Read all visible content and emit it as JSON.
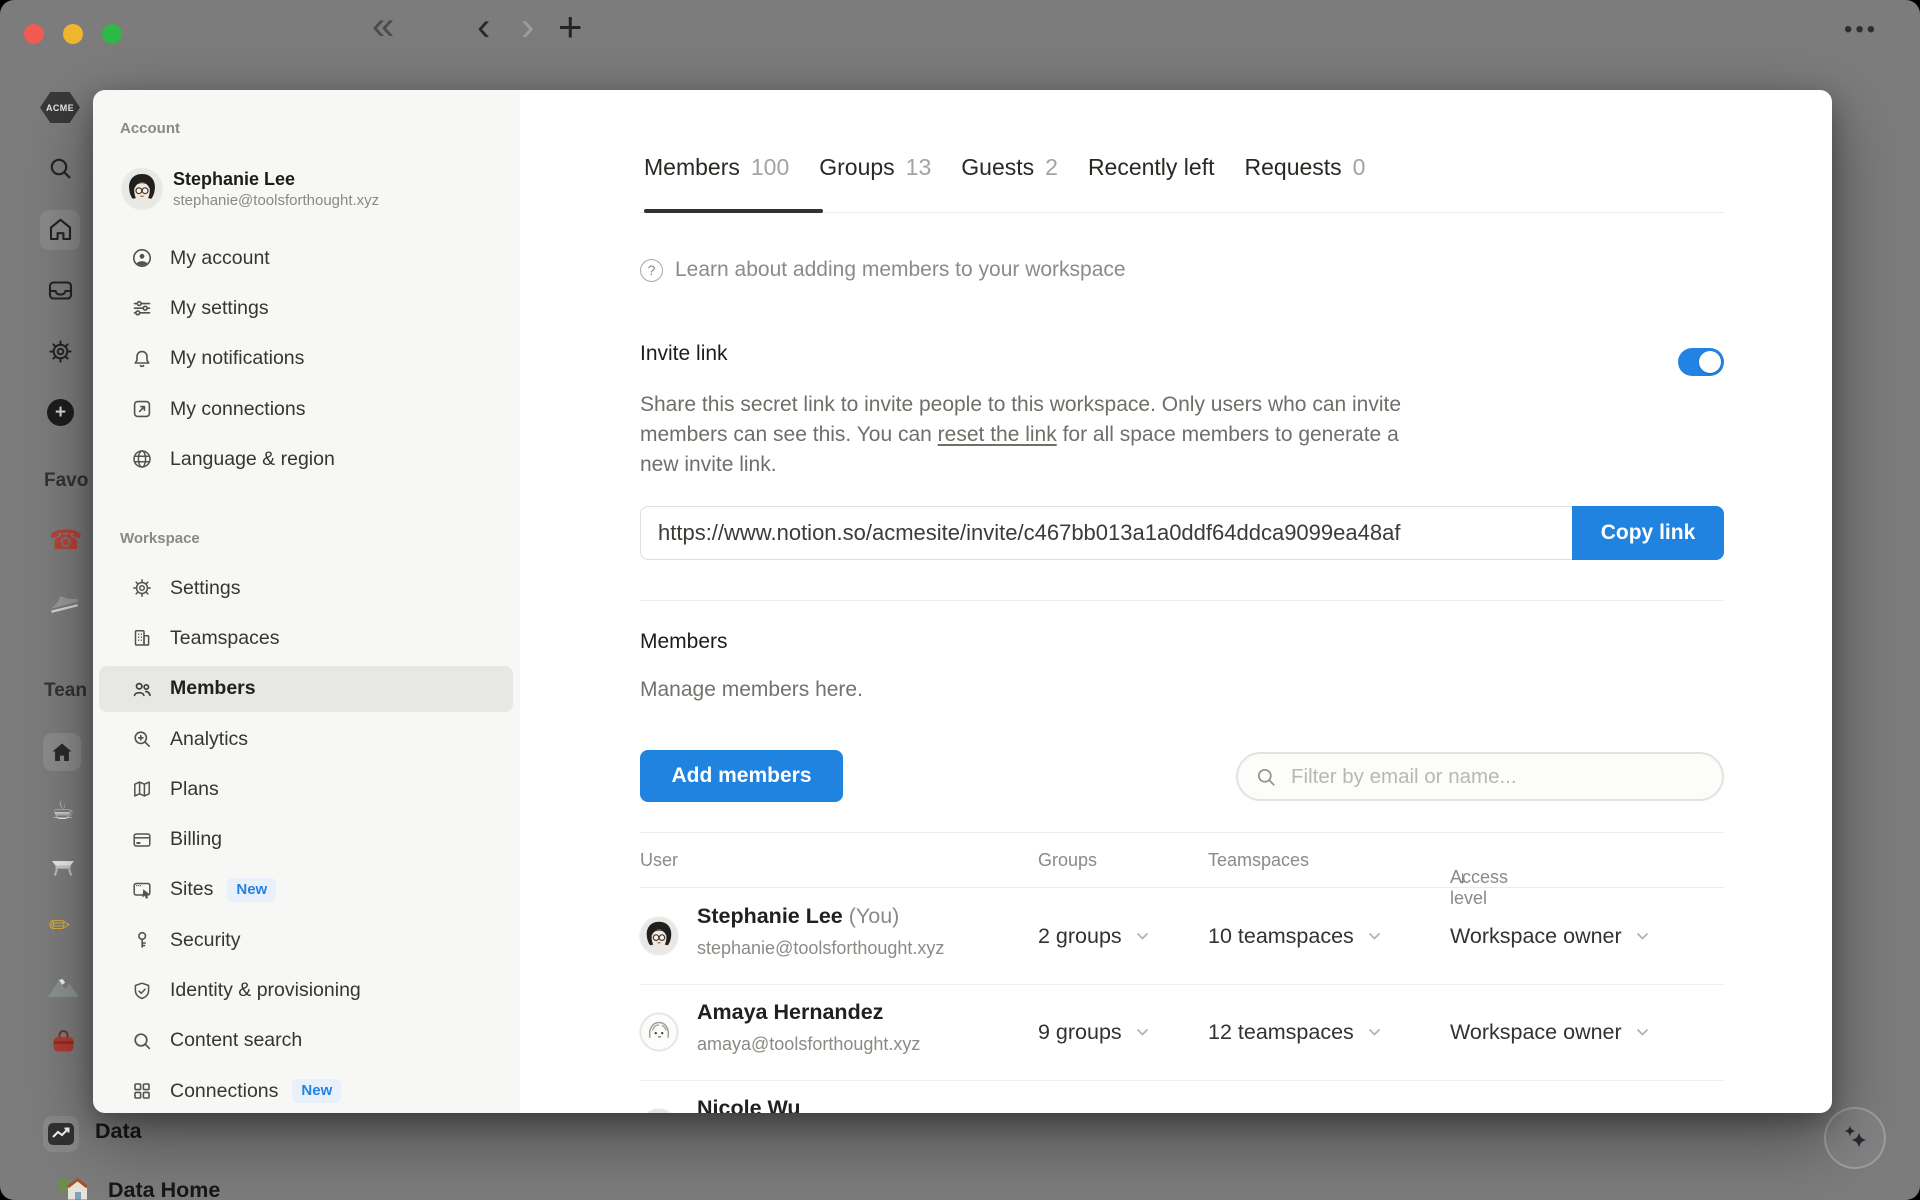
{
  "window": {
    "icons": {
      "collapse": "«",
      "back": "‹",
      "forward": "›",
      "new_tab": "+",
      "more": "•••",
      "help": "?",
      "plus": "+"
    }
  },
  "background": {
    "logo_text": "ACME",
    "favorites_label": "Favo",
    "teamspaces_label": "Tean",
    "data_label": "Data",
    "data_home_label": "Data Home"
  },
  "modal": {
    "sidebar": {
      "account_label": "Account",
      "user": {
        "name": "Stephanie Lee",
        "email": "stephanie@toolsforthought.xyz"
      },
      "account_items": [
        {
          "label": "My account"
        },
        {
          "label": "My settings"
        },
        {
          "label": "My notifications"
        },
        {
          "label": "My connections"
        },
        {
          "label": "Language & region"
        }
      ],
      "workspace_label": "Workspace",
      "workspace_items": [
        {
          "label": "Settings"
        },
        {
          "label": "Teamspaces"
        },
        {
          "label": "Members"
        },
        {
          "label": "Analytics"
        },
        {
          "label": "Plans"
        },
        {
          "label": "Billing"
        },
        {
          "label": "Sites",
          "badge": "New"
        },
        {
          "label": "Security"
        },
        {
          "label": "Identity & provisioning"
        },
        {
          "label": "Content search"
        },
        {
          "label": "Connections",
          "badge": "New"
        }
      ]
    },
    "tabs": [
      {
        "label": "Members",
        "count": "100"
      },
      {
        "label": "Groups",
        "count": "13"
      },
      {
        "label": "Guests",
        "count": "2"
      },
      {
        "label": "Recently left"
      },
      {
        "label": "Requests",
        "count": "0"
      }
    ],
    "learn_text": "Learn about adding members to your workspace",
    "invite": {
      "title": "Invite link",
      "desc_line1": "Share this secret link to invite people to this workspace. Only users who can invite",
      "desc_line2_pre": "members can see this. You can ",
      "reset_link": "reset the link",
      "desc_line2_post": " for all space members to generate a",
      "desc_line3": "new invite link.",
      "url": "https://www.notion.so/acmesite/invite/c467bb013a1a0ddf64ddca9099ea48af",
      "copy_label": "Copy link"
    },
    "members": {
      "title": "Members",
      "subtitle": "Manage members here.",
      "add_label": "Add members",
      "filter_placeholder": "Filter by email or name...",
      "table": {
        "columns": [
          "User",
          "Groups",
          "Teamspaces",
          "Access level"
        ],
        "sort_icon": "↓",
        "rows": [
          {
            "name": "Stephanie Lee",
            "you": " (You)",
            "email": "stephanie@toolsforthought.xyz",
            "groups": "2 groups",
            "teamspaces": "10 teamspaces",
            "access": "Workspace owner"
          },
          {
            "name": "Amaya Hernandez",
            "you": "",
            "email": "amaya@toolsforthought.xyz",
            "groups": "9 groups",
            "teamspaces": "12 teamspaces",
            "access": "Workspace owner"
          },
          {
            "name": "Nicole Wu",
            "you": "",
            "email": "",
            "groups": "",
            "teamspaces": "",
            "access": ""
          }
        ]
      }
    }
  },
  "colors": {
    "accent": "#2383e2",
    "badge_bg": "#e7f0fb",
    "modal_sidebar_bg": "#f7f7f5",
    "overlay_gray": "#7c7c7c",
    "traffic_red": "#ff5f57",
    "traffic_yellow": "#febc2e",
    "traffic_green": "#28c840"
  }
}
